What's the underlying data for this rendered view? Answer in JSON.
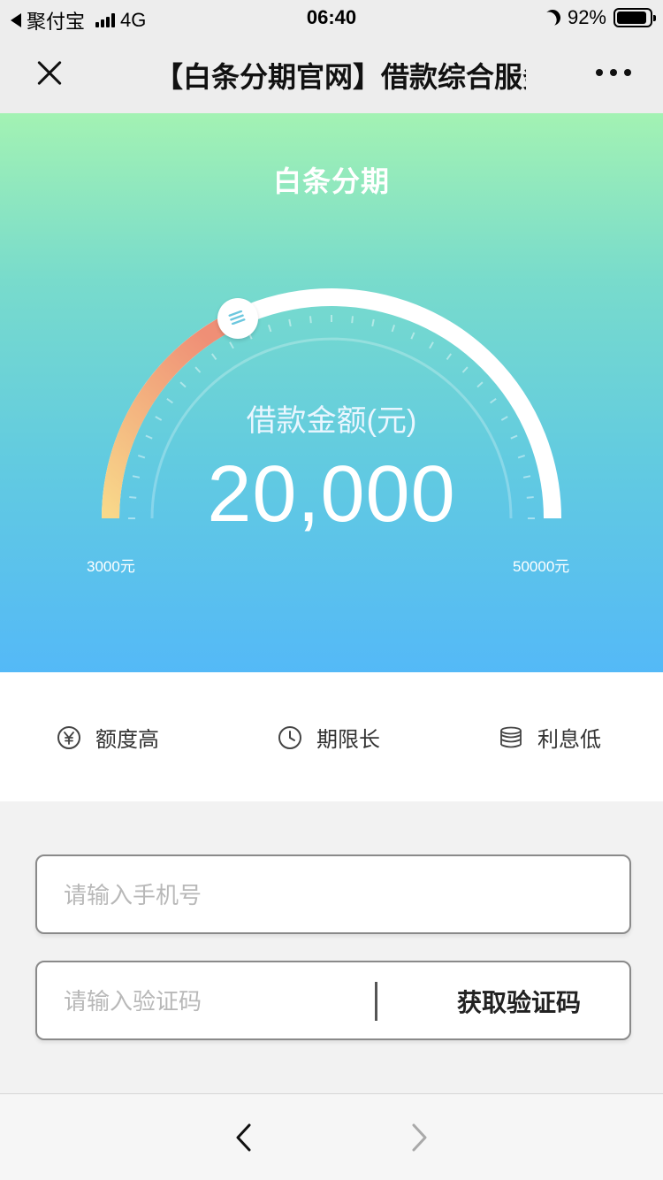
{
  "status_bar": {
    "carrier": "聚付宝",
    "network": "4G",
    "time": "06:40",
    "battery_percent": "92%",
    "battery_level": 0.92
  },
  "nav": {
    "title": "【白条分期官网】借款综合服务"
  },
  "hero": {
    "title": "白条分期",
    "amount_label": "借款金额(元)",
    "amount_value": "20,000",
    "min_label": "3000元",
    "max_label": "50000元",
    "slider_fraction": 0.36
  },
  "features": [
    {
      "label": "额度高",
      "icon": "yen-circle-icon"
    },
    {
      "label": "期限长",
      "icon": "clock-icon"
    },
    {
      "label": "利息低",
      "icon": "coin-stack-icon"
    }
  ],
  "form": {
    "phone_placeholder": "请输入手机号",
    "code_placeholder": "请输入验证码",
    "get_code_label": "获取验证码"
  },
  "colors": {
    "gradient_top": "#a3f2b3",
    "gradient_bottom": "#54b9f7",
    "arc_warm_start": "#f8d98a",
    "arc_warm_end": "#ef8f76"
  }
}
